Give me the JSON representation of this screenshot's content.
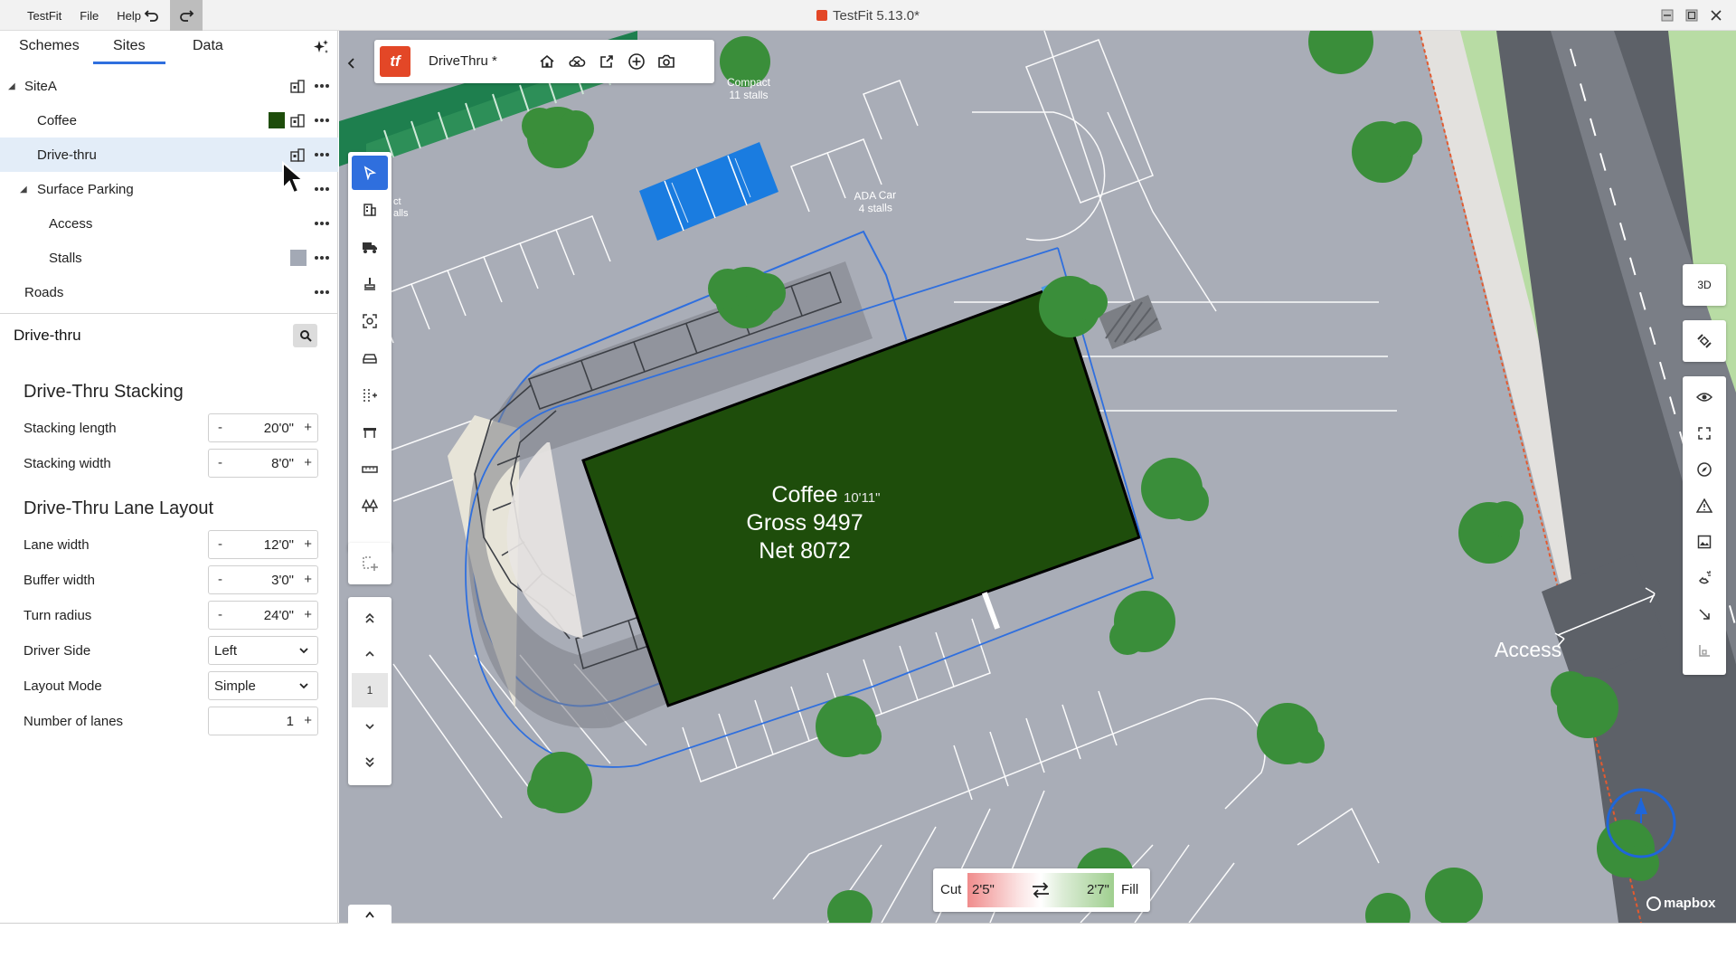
{
  "menu": {
    "app": "TestFit",
    "file": "File",
    "help": "Help"
  },
  "window": {
    "title": "TestFit 5.13.0*"
  },
  "tabs": [
    {
      "label": "Schemes"
    },
    {
      "label": "Sites"
    },
    {
      "label": "Data"
    }
  ],
  "tree": {
    "site": "SiteA",
    "coffee": "Coffee",
    "drive_thru": "Drive-thru",
    "surface_parking": "Surface Parking",
    "access": "Access",
    "stalls": "Stalls",
    "roads": "Roads"
  },
  "colors": {
    "coffee_swatch": "#1e4d0b",
    "stalls_swatch": "#a3a9b5",
    "accent": "#2f6fde",
    "brand": "#e34727"
  },
  "properties": {
    "title": "Drive-thru",
    "stacking_section": "Drive-Thru Stacking",
    "stacking_length_label": "Stacking length",
    "stacking_length_value": "20'0\"",
    "stacking_width_label": "Stacking width",
    "stacking_width_value": "8'0\"",
    "lane_section": "Drive-Thru Lane Layout",
    "lane_width_label": "Lane width",
    "lane_width_value": "12'0\"",
    "buffer_width_label": "Buffer width",
    "buffer_width_value": "3'0\"",
    "turn_radius_label": "Turn radius",
    "turn_radius_value": "24'0\"",
    "driver_side_label": "Driver Side",
    "driver_side_value": "Left",
    "layout_mode_label": "Layout Mode",
    "layout_mode_value": "Simple",
    "lanes_label": "Number of lanes",
    "lanes_value": "1",
    "minus": "-",
    "plus": "+"
  },
  "toolbar": {
    "doc_name": "DriveThru *",
    "logo_text": "tf"
  },
  "left_tools": {
    "level": "1"
  },
  "right_tools": {
    "view_3d": "3D"
  },
  "map": {
    "building_name": "Coffee",
    "building_gross": "Gross 9497",
    "building_net": "Net 8072",
    "ada_label": "ADA Car",
    "ada_stalls": "4 stalls",
    "compact_label": "Compact",
    "compact_stalls": "11 stalls",
    "compact_partial_1": "ct",
    "compact_partial_2": "alls",
    "dimension": "10'11\"",
    "access_label": "Access",
    "attribution": "mapbox"
  },
  "cut_fill": {
    "cut_label": "Cut",
    "cut_value": "2'5\"",
    "fill_value": "2'7\"",
    "fill_label": "Fill"
  }
}
